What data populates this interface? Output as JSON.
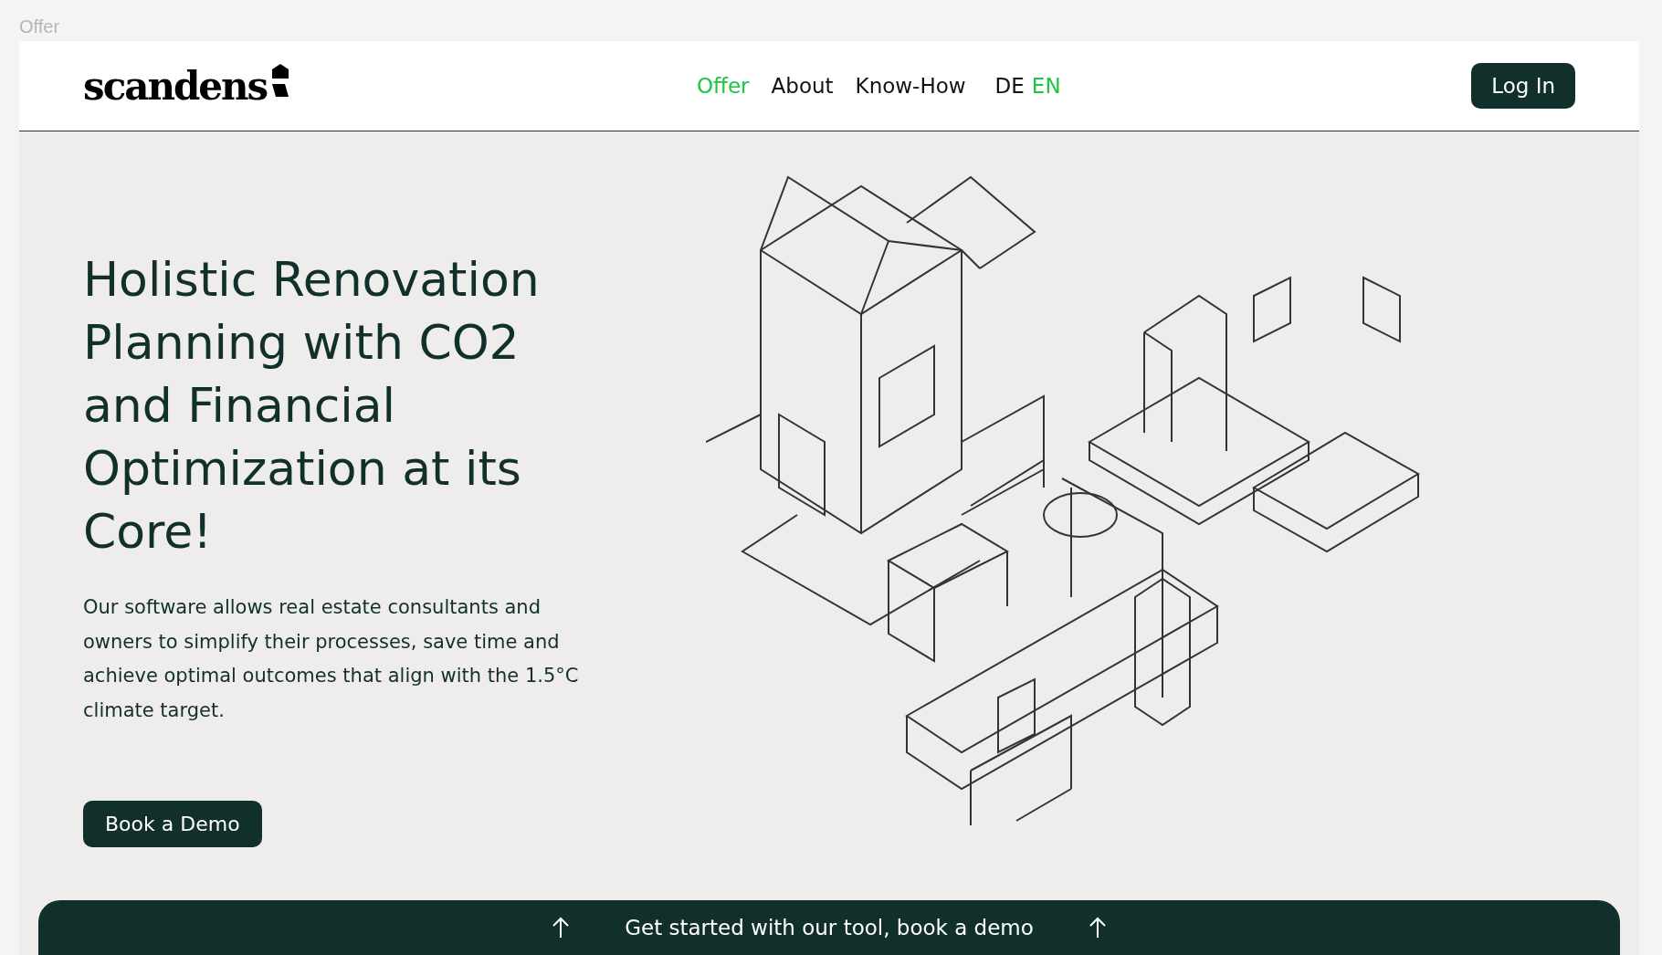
{
  "page_label": "Offer",
  "header": {
    "logo": "scandens",
    "nav": [
      {
        "label": "Offer",
        "selected": true
      },
      {
        "label": "About",
        "selected": false
      },
      {
        "label": "Know-How",
        "selected": false
      }
    ],
    "languages": [
      {
        "label": "DE",
        "selected": false
      },
      {
        "label": "EN",
        "selected": true
      }
    ],
    "login": "Log In"
  },
  "hero": {
    "title": "Holistic Renovation Planning with CO2 and Financial Optimization at its Core!",
    "text": "Our software allows real estate consultants and owners to simplify their processes, save time and achieve optimal outcomes that align with the 1.5°C climate target.",
    "button": "Book a Demo"
  },
  "banner": {
    "text": "Get started with our tool, book a demo"
  }
}
